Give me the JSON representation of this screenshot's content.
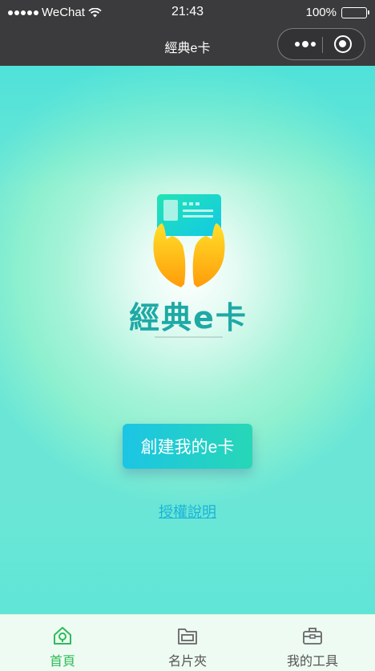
{
  "status_bar": {
    "carrier": "WeChat",
    "time": "21:43",
    "battery": "100%",
    "battery_level": 1.0
  },
  "nav": {
    "title": "經典e卡"
  },
  "main": {
    "brand": "經典e卡",
    "create_button": "創建我的e卡",
    "auth_link": "授權說明"
  },
  "tab_bar": {
    "items": [
      {
        "label": "首頁",
        "icon": "home-icon",
        "active": true
      },
      {
        "label": "名片夾",
        "icon": "folder-icon",
        "active": false
      },
      {
        "label": "我的工具",
        "icon": "toolbox-icon",
        "active": false
      }
    ]
  },
  "colors": {
    "active_tab": "#2dbb5a",
    "inactive_tab": "#555555",
    "button_start": "#1cc5e4",
    "button_end": "#27d7b6",
    "link": "#1bb3d8",
    "brand": "#1ea9a5"
  }
}
